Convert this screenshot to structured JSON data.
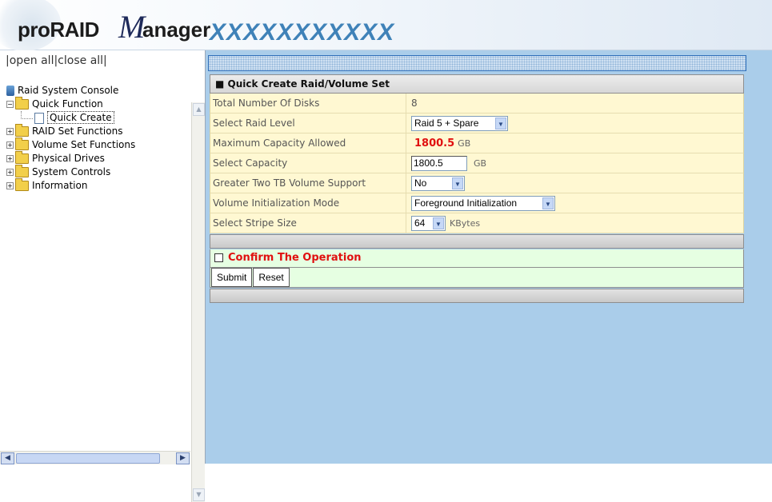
{
  "header": {
    "logo_pro": "proRAID",
    "logo_m": "M",
    "logo_anager": "anager",
    "title": "XXXXXXXXXXX"
  },
  "sidebar": {
    "top_links": "|open all|close all|",
    "tree": {
      "root": "Raid System Console",
      "items": [
        {
          "label": "Quick Function",
          "expanded": true,
          "children": [
            {
              "label": "Quick Create",
              "selected": true
            }
          ]
        },
        {
          "label": "RAID Set Functions",
          "expanded": false
        },
        {
          "label": "Volume Set Functions",
          "expanded": false
        },
        {
          "label": "Physical Drives",
          "expanded": false
        },
        {
          "label": "System Controls",
          "expanded": false
        },
        {
          "label": "Information",
          "expanded": false
        }
      ]
    }
  },
  "form": {
    "title": "Quick Create Raid/Volume Set",
    "rows": [
      {
        "label": "Total Number Of Disks",
        "value": "8"
      },
      {
        "label": "Select Raid Level",
        "value": "Raid 5 + Spare"
      },
      {
        "label": "Maximum Capacity Allowed",
        "value": "1800.5",
        "unit": "GB"
      },
      {
        "label": "Select Capacity",
        "value": "1800.5",
        "unit": "GB"
      },
      {
        "label": "Greater Two TB Volume Support",
        "value": "No"
      },
      {
        "label": "Volume Initialization Mode",
        "value": "Foreground Initialization"
      },
      {
        "label": "Select Stripe Size",
        "value": "64",
        "unit": "KBytes"
      }
    ],
    "confirm_label": "Confirm The Operation",
    "submit_label": "Submit",
    "reset_label": "Reset"
  },
  "colors": {
    "main_bg": "#aacdea",
    "row_bg": "#fff8d2",
    "confirm_bg": "#e6ffe2",
    "accent_red": "#e01010",
    "title_blue": "#3f82b8"
  }
}
